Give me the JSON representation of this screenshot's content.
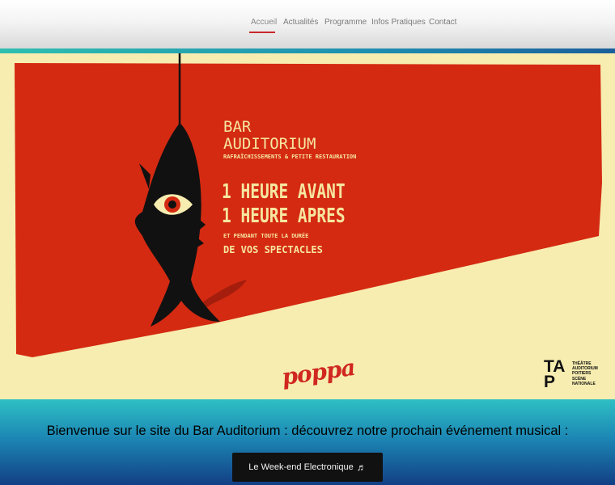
{
  "nav": {
    "items": [
      {
        "label": "Accueil",
        "active": true
      },
      {
        "label": "Actualités"
      },
      {
        "label": "Programme"
      },
      {
        "label": "Infos Pratiques"
      },
      {
        "label": "Contact"
      }
    ]
  },
  "poster": {
    "title_line1": "BAR",
    "title_line2": "AUDITORIUM",
    "subtitle": "RAFRAÎCHISSEMENTS & PETITE RESTAURATION",
    "line1": "1 HEURE AVANT",
    "line2": "1 HEURE APRES",
    "line3": "ET PENDANT TOUTE LA DURÉE",
    "line4": "DE VOS SPECTACLES",
    "poppa_logo": "poppa",
    "tap_letters": "TA P",
    "tap_caption": [
      "THÉÂTRE",
      "AUDITORIUM",
      "POITIERS",
      "SCÈNE",
      "NATIONALE"
    ],
    "colors": {
      "red": "#d42a12",
      "cream": "#f7edb0",
      "black": "#111111"
    }
  },
  "main": {
    "welcome": "Bienvenue sur le site du Bar Auditorium : découvrez notre prochain événement musical :",
    "cta_label": "Le Week-end Electronique",
    "cta_icon": "music-note-icon"
  },
  "colors": {
    "accent": "#c8282a",
    "bottom_top": "#2ec0c4",
    "bottom_bottom": "#123f85"
  }
}
